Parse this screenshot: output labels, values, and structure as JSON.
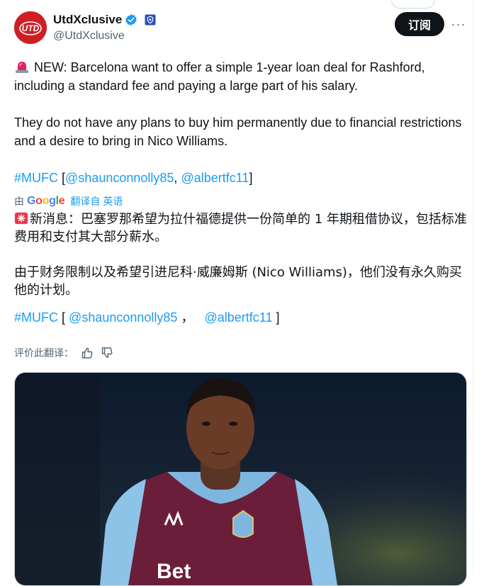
{
  "header": {
    "display_name": "UtdXclusive",
    "handle": "@UtdXclusive",
    "subscribe_label": "订阅",
    "more_label": "···",
    "avatar_text": "UTD"
  },
  "tweet": {
    "p1": "NEW: Barcelona want to offer a simple 1-year loan deal for Rashford, including a standard fee and paying a large part of his salary.",
    "p2": "They do not have any plans to buy him permanently due to financial restrictions and a desire to bring in Nico Williams.",
    "hashtag": "#MUFC",
    "bracket_open": "[",
    "mention1": "@shaunconnolly85",
    "comma": ", ",
    "mention2": "@albertfc11",
    "bracket_close": "]"
  },
  "translation": {
    "by_label": "由",
    "google": "Google",
    "from_label": "翻译自 英语",
    "p1": "新消息：巴塞罗那希望为拉什福德提供一份简单的 1 年期租借协议，包括标准费用和支付其大部分薪水。",
    "p2": "由于财务限制以及希望引进尼科·威廉姆斯 (Nico Williams)，他们没有永久购买他的计划。",
    "hashtag": "#MUFC",
    "bracket_open": "[",
    "mention1": "@shaunconnolly85",
    "comma": "，",
    "mention2": "@albertfc11",
    "bracket_close": "]",
    "rate_label": "评价此翻译："
  },
  "icons": {
    "verified": "verified-badge-icon",
    "affiliate": "affiliate-badge-icon",
    "siren": "rotating-light-icon",
    "thumbs_up": "thumbs-up-icon",
    "thumbs_down": "thumbs-down-icon"
  },
  "colors": {
    "accent": "#1d9bf0",
    "text": "#0f1419",
    "muted": "#536471",
    "avatar_bg": "#cf1f25"
  }
}
